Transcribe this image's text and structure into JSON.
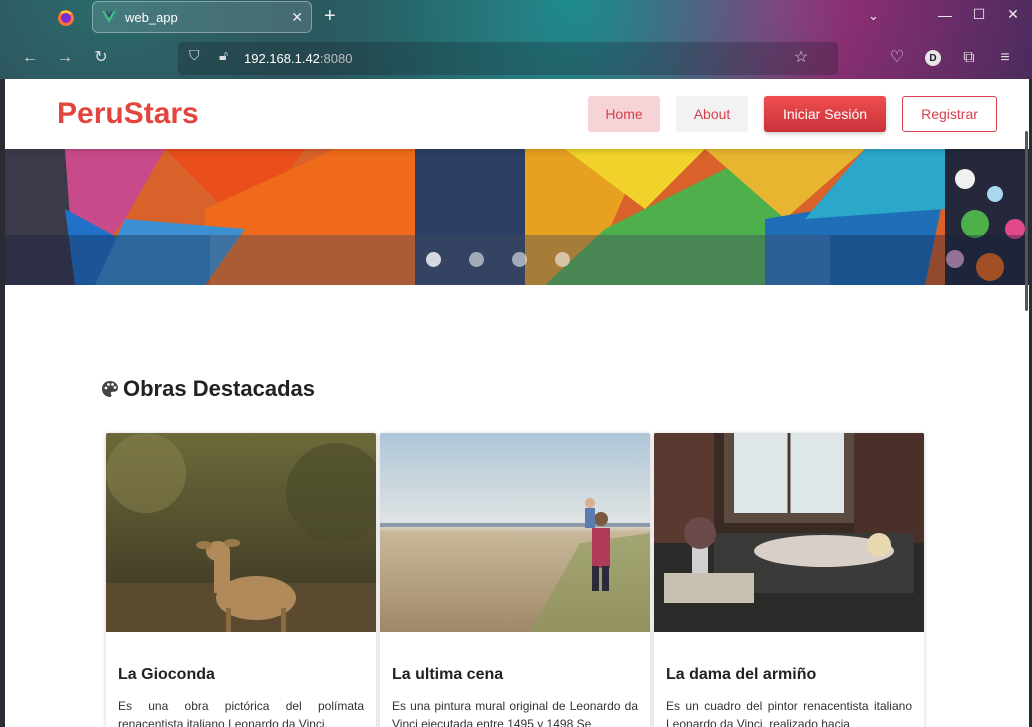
{
  "browser": {
    "tab_title": "web_app",
    "url_host": "192.168.1.42",
    "url_port": ":8080",
    "profile_initial": "D"
  },
  "header": {
    "brand": "PeruStars",
    "nav": {
      "home": "Home",
      "about": "About",
      "login": "Iniciar Sesión",
      "register": "Registrar"
    }
  },
  "carousel": {
    "slide_count": 4,
    "active_index": 0
  },
  "section": {
    "title": "Obras Destacadas"
  },
  "cards": [
    {
      "title": "La Gioconda",
      "desc": "Es una obra pictórica del polímata renacentista italiano Leonardo da Vinci."
    },
    {
      "title": "La ultima cena",
      "desc": "Es una pintura mural original de Leonardo da Vinci ejecutada entre 1495 y 1498 Se"
    },
    {
      "title": "La dama del armiño",
      "desc": "Es un cuadro del pintor renacentista italiano Leonardo da Vinci, realizado hacia"
    }
  ],
  "colors": {
    "brand": "#e2453d",
    "accent": "#d6404a"
  }
}
